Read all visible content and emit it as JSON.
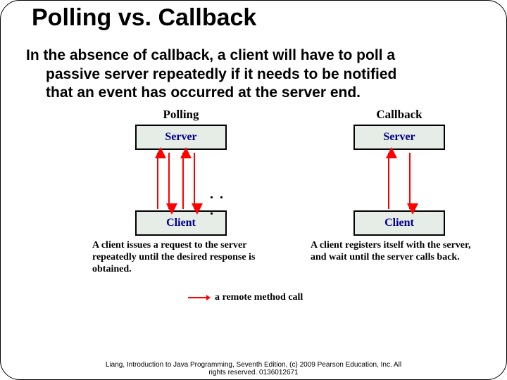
{
  "title": "Polling vs. Callback",
  "body_line1": "In the absence of callback, a client will have to poll a",
  "body_line2": "passive server repeatedly if it needs to be notified",
  "body_line3": "that an event has occurred at the server end.",
  "diagram": {
    "polling": {
      "heading": "Polling",
      "server": "Server",
      "client": "Client",
      "ellipsis": ". . .",
      "caption": "A client issues a request to the server repeatedly until the desired response is obtained."
    },
    "callback": {
      "heading": "Callback",
      "server": "Server",
      "client": "Client",
      "caption": "A client registers itself with the server, and wait until the server calls back."
    },
    "legend": "a remote method call",
    "arrow_color": "#ff0000"
  },
  "footer": "Liang, Introduction to Java Programming, Seventh Edition, (c) 2009 Pearson Education, Inc. All\nrights reserved. 0136012671"
}
